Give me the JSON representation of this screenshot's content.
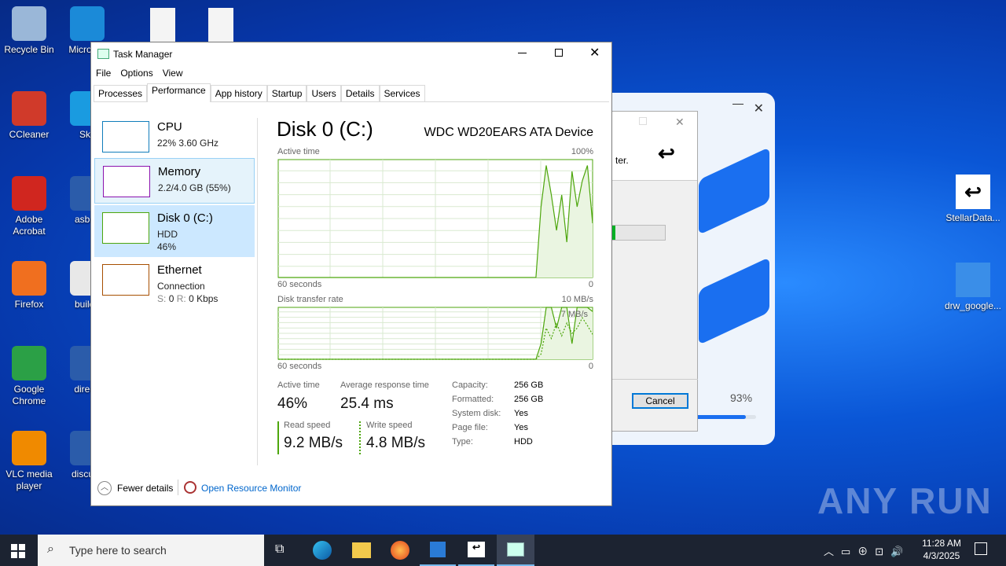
{
  "desktop": {
    "icons": [
      {
        "label": "Recycle Bin",
        "color": "#9ab7d8"
      },
      {
        "label": "Micro Ed",
        "color": "#1b8ad8"
      },
      {
        "label": "CCleaner",
        "color": "#d03a2a"
      },
      {
        "label": "Sky",
        "color": "#1a9be0"
      },
      {
        "label": "Adobe Acrobat",
        "color": "#d0261f"
      },
      {
        "label": "asbac",
        "color": "#2b5caa"
      },
      {
        "label": "Firefox",
        "color": "#f06f1f"
      },
      {
        "label": "builde",
        "color": "#e8e8e8"
      },
      {
        "label": "Google Chrome",
        "color": "#2ba046"
      },
      {
        "label": "directr",
        "color": "#2b5caa"
      },
      {
        "label": "VLC media player",
        "color": "#f08a00"
      },
      {
        "label": "discuss",
        "color": "#2b5caa"
      }
    ],
    "right_icons": [
      {
        "label": "StellarData..."
      },
      {
        "label": "drw_google..."
      }
    ]
  },
  "task_manager": {
    "title": "Task Manager",
    "menu": [
      "File",
      "Options",
      "View"
    ],
    "tabs": [
      "Processes",
      "Performance",
      "App history",
      "Startup",
      "Users",
      "Details",
      "Services"
    ],
    "active_tab": "Performance",
    "sidebar": [
      {
        "name": "CPU",
        "line1": "22%  3.60 GHz",
        "color": "#117dbb"
      },
      {
        "name": "Memory",
        "line1": "2.2/4.0 GB (55%)",
        "color": "#8b12ae"
      },
      {
        "name": "Disk 0 (C:)",
        "line1": "HDD",
        "line2": "46%",
        "color": "#4da60c"
      },
      {
        "name": "Ethernet",
        "line1": "Connection",
        "line2_s": "S:",
        "line2_sv": "0",
        "line2_r": "R:",
        "line2_rv": "0 Kbps",
        "color": "#a74f01"
      }
    ],
    "main": {
      "title": "Disk 0 (C:)",
      "device": "WDC WD20EARS ATA Device",
      "active_label": "Active time",
      "active_max": "100%",
      "seconds": "60 seconds",
      "zero": "0",
      "transfer_label": "Disk transfer rate",
      "transfer_max": "10 MB/s",
      "transfer_mid": "7 MB/s",
      "active_time_values": [
        0,
        0,
        0,
        0,
        0,
        0,
        0,
        0,
        0,
        0,
        0,
        0,
        0,
        0,
        0,
        0,
        0,
        0,
        0,
        0,
        0,
        0,
        0,
        0,
        0,
        0,
        0,
        0,
        0,
        0,
        0,
        0,
        0,
        0,
        0,
        0,
        0,
        0,
        0,
        0,
        0,
        0,
        0,
        0,
        0,
        0,
        0,
        0,
        0,
        0,
        0,
        60,
        95,
        70,
        40,
        70,
        30,
        90,
        60,
        82,
        95,
        46
      ],
      "read_values": [
        0,
        0,
        0,
        0,
        0,
        0,
        0,
        0,
        0,
        0,
        0,
        0,
        0,
        0,
        0,
        0,
        0,
        0,
        0,
        0,
        0,
        0,
        0,
        0,
        0,
        0,
        0,
        0,
        0,
        0,
        0,
        0,
        0,
        0,
        0,
        0,
        0,
        0,
        0,
        0,
        0,
        0,
        0,
        0,
        0,
        0,
        0,
        0,
        0,
        0,
        0,
        30,
        100,
        100,
        60,
        100,
        100,
        30,
        100,
        100,
        100,
        92
      ],
      "write_values": [
        0,
        0,
        0,
        0,
        0,
        0,
        0,
        0,
        0,
        0,
        0,
        0,
        0,
        0,
        0,
        0,
        0,
        0,
        0,
        0,
        0,
        0,
        0,
        0,
        0,
        0,
        0,
        0,
        0,
        0,
        0,
        0,
        0,
        0,
        0,
        0,
        0,
        0,
        0,
        0,
        0,
        0,
        0,
        0,
        0,
        0,
        0,
        0,
        0,
        0,
        0,
        10,
        60,
        40,
        70,
        45,
        70,
        50,
        60,
        80,
        65,
        48
      ],
      "stats": {
        "active_time": "46%",
        "avg_response_label": "Average response time",
        "avg_response": "25.4 ms",
        "read_label": "Read speed",
        "read": "9.2 MB/s",
        "write_label": "Write speed",
        "write": "4.8 MB/s"
      },
      "props": [
        [
          "Capacity:",
          "256 GB"
        ],
        [
          "Formatted:",
          "256 GB"
        ],
        [
          "System disk:",
          "Yes"
        ],
        [
          "Page file:",
          "Yes"
        ],
        [
          "Type:",
          "HDD"
        ]
      ]
    },
    "footer": {
      "fewer": "Fewer details",
      "resmon": "Open Resource Monitor"
    }
  },
  "installer": {
    "text": "ter.",
    "cancel": "Cancel",
    "percent": "93%",
    "progress": 0.93
  },
  "watermark": "ANY RUN",
  "taskbar": {
    "search_placeholder": "Type here to search",
    "time": "11:28 AM",
    "date": "4/3/2025"
  }
}
